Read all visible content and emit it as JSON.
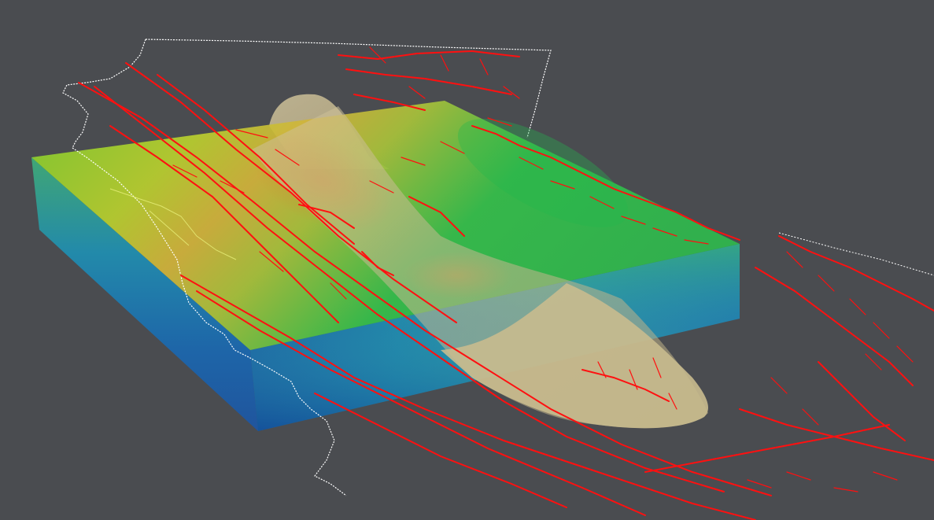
{
  "viewport": {
    "background_color": "#4a4c50"
  },
  "scene": {
    "layers": [
      {
        "name": "terrain-volume",
        "colormap": [
          "#0a3d8f",
          "#1a7fb8",
          "#2bb84a",
          "#8fcf2c",
          "#d9c23a",
          "#c98a2e"
        ]
      },
      {
        "name": "fault-traces",
        "color": "#ff1010"
      },
      {
        "name": "coastline",
        "color": "#ffffff"
      },
      {
        "name": "subducting-slab-surface",
        "color": "#c9bb8e"
      }
    ]
  }
}
